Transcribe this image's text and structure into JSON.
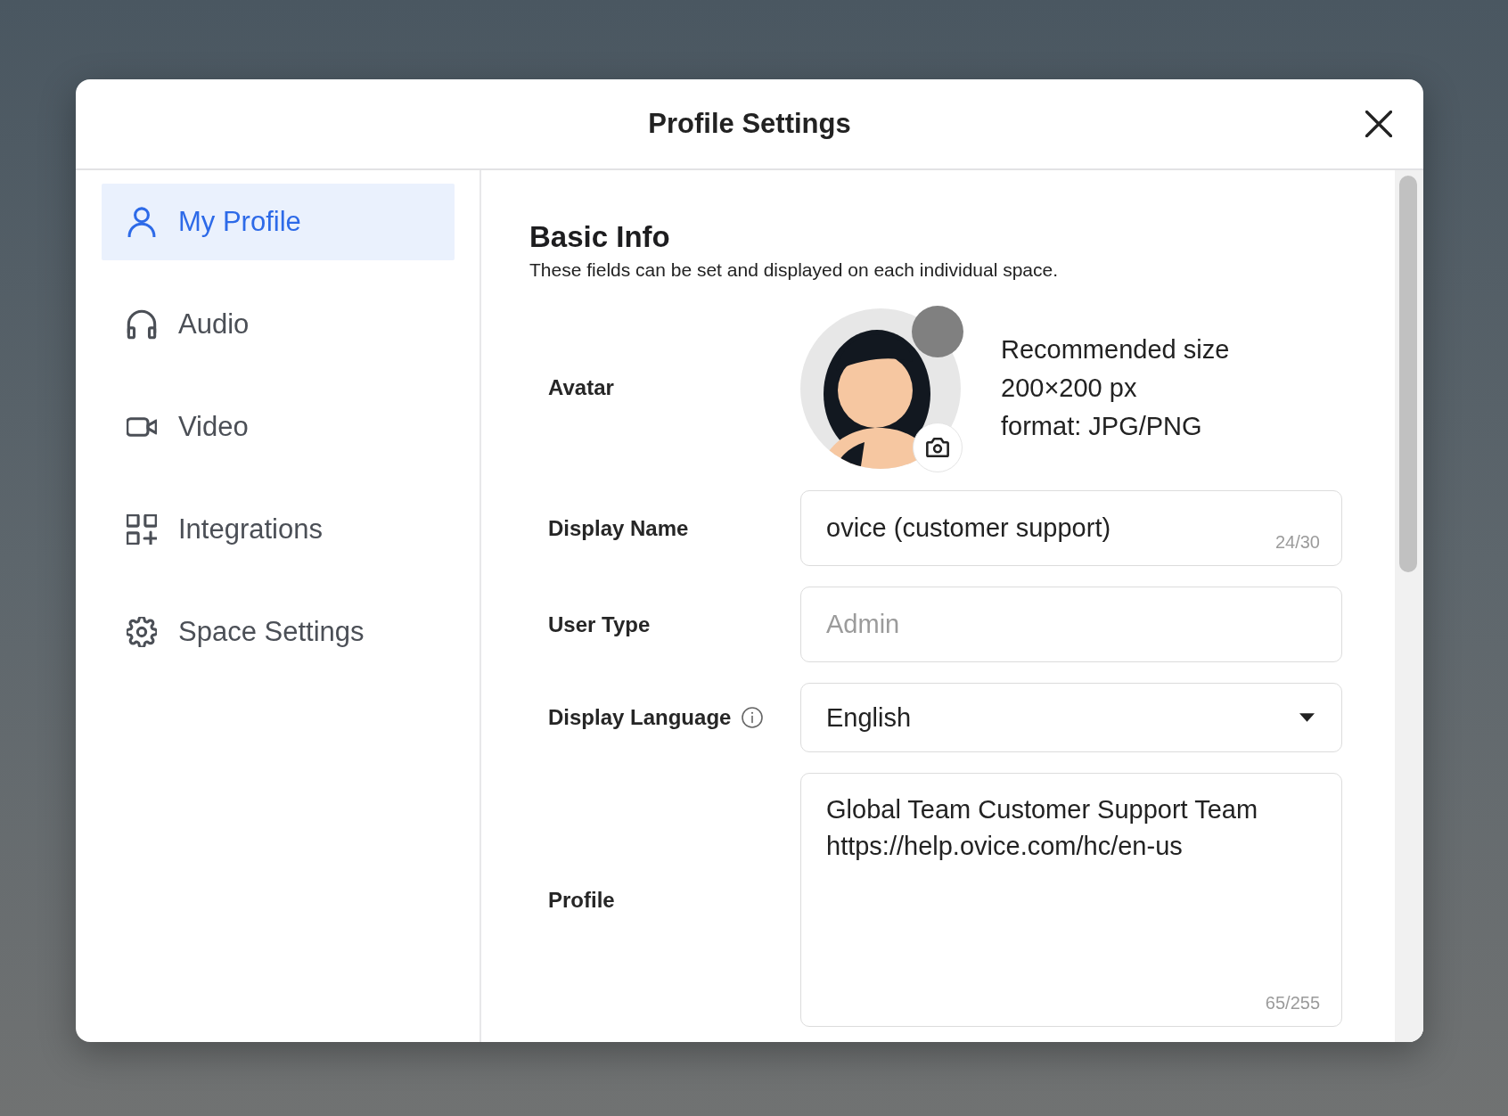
{
  "dialog": {
    "title": "Profile Settings"
  },
  "sidebar": {
    "items": [
      {
        "label": "My Profile",
        "kind": "profile",
        "selected": true
      },
      {
        "label": "Audio",
        "kind": "audio",
        "selected": false
      },
      {
        "label": "Video",
        "kind": "video",
        "selected": false
      },
      {
        "label": "Integrations",
        "kind": "integrations",
        "selected": false
      },
      {
        "label": "Space Settings",
        "kind": "settings",
        "selected": false
      }
    ]
  },
  "section": {
    "title": "Basic Info",
    "description": "These fields can be set and displayed on each individual space."
  },
  "avatar": {
    "label": "Avatar",
    "hints": [
      "Recommended size",
      "200×200 px",
      "format: JPG/PNG"
    ]
  },
  "fields": [
    {
      "kind": "text",
      "label": "Display Name",
      "value": "ovice (customer support)",
      "counter": "24/30",
      "disabled": false,
      "info": false
    },
    {
      "kind": "text",
      "label": "User Type",
      "value": "Admin",
      "disabled": true,
      "info": false
    },
    {
      "kind": "select",
      "label": "Display Language",
      "value": "English",
      "disabled": false,
      "info": true
    },
    {
      "kind": "textarea",
      "label": "Profile",
      "value": "Global Team Customer Support Team\nhttps://help.ovice.com/hc/en-us",
      "counter": "65/255",
      "disabled": false,
      "info": false
    }
  ]
}
